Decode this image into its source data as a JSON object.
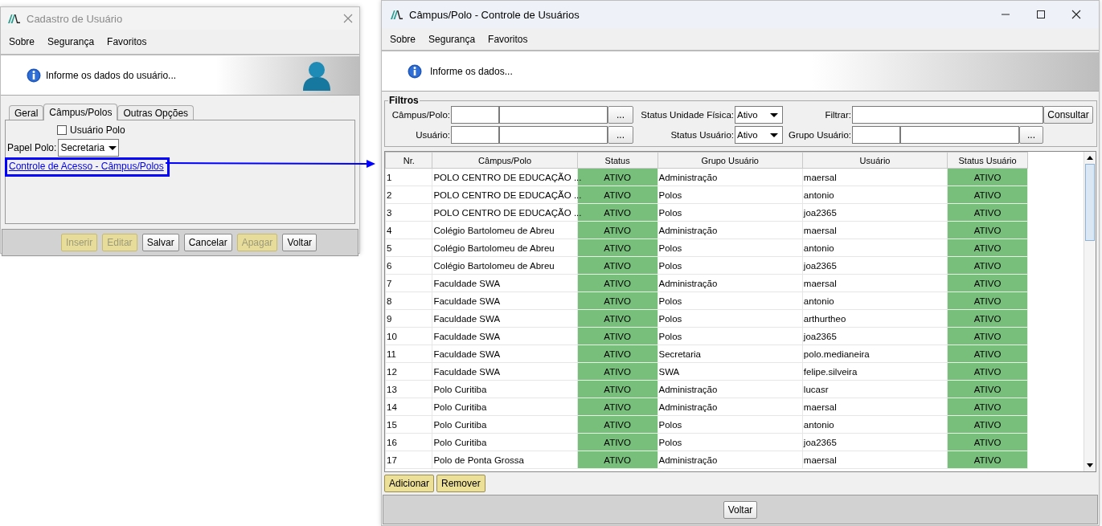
{
  "user_window": {
    "title": "Cadastro de Usuário",
    "menu": [
      "Sobre",
      "Segurança",
      "Favoritos"
    ],
    "banner_text": "Informe os dados do usuário...",
    "tabs": [
      {
        "label": "Geral",
        "selected": false
      },
      {
        "label": "Câmpus/Polos",
        "selected": true
      },
      {
        "label": "Outras Opções",
        "selected": false
      }
    ],
    "polo_user": {
      "label": "Usuário Polo",
      "checked": false
    },
    "role": {
      "label": "Papel Polo:",
      "value": "Secretaria"
    },
    "link": "Controle de Acesso - Câmpus/Polos",
    "buttons": [
      {
        "label": "Inserir",
        "disabled": true
      },
      {
        "label": "Editar",
        "disabled": true
      },
      {
        "label": "Salvar",
        "disabled": false
      },
      {
        "label": "Cancelar",
        "disabled": false
      },
      {
        "label": "Apagar",
        "disabled": true
      },
      {
        "label": "Voltar",
        "disabled": false
      }
    ]
  },
  "control_window": {
    "title": "Câmpus/Polo - Controle de Usuários",
    "menu": [
      "Sobre",
      "Segurança",
      "Favoritos"
    ],
    "banner_text": "Informe os dados...",
    "filters": {
      "title": "Filtros",
      "campus_label": "Câmpus/Polo:",
      "campus_browse": "...",
      "unit_status_label": "Status Unidade Física:",
      "unit_status_value": "Ativo",
      "filter_label": "Filtrar:",
      "search_button": "Consultar",
      "user_label": "Usuário:",
      "user_browse": "...",
      "user_status_label": "Status Usuário:",
      "user_status_value": "Ativo",
      "group_label": "Grupo Usuário:",
      "group_browse": "..."
    },
    "table": {
      "columns": [
        "Nr.",
        "Câmpus/Polo",
        "Status",
        "Grupo Usuário",
        "Usuário",
        "Status Usuário"
      ],
      "rows": [
        [
          "1",
          "POLO CENTRO DE EDUCAÇÃO ...",
          "ATIVO",
          "Administração",
          "maersal",
          "ATIVO"
        ],
        [
          "2",
          "POLO CENTRO DE EDUCAÇÃO ...",
          "ATIVO",
          "Polos",
          "antonio",
          "ATIVO"
        ],
        [
          "3",
          "POLO CENTRO DE EDUCAÇÃO ...",
          "ATIVO",
          "Polos",
          "joa2365",
          "ATIVO"
        ],
        [
          "4",
          "Colégio Bartolomeu de Abreu",
          "ATIVO",
          "Administração",
          "maersal",
          "ATIVO"
        ],
        [
          "5",
          "Colégio Bartolomeu de Abreu",
          "ATIVO",
          "Polos",
          "antonio",
          "ATIVO"
        ],
        [
          "6",
          "Colégio Bartolomeu de Abreu",
          "ATIVO",
          "Polos",
          "joa2365",
          "ATIVO"
        ],
        [
          "7",
          "Faculdade SWA",
          "ATIVO",
          "Administração",
          "maersal",
          "ATIVO"
        ],
        [
          "8",
          "Faculdade SWA",
          "ATIVO",
          "Polos",
          "antonio",
          "ATIVO"
        ],
        [
          "9",
          "Faculdade SWA",
          "ATIVO",
          "Polos",
          "arthurtheo",
          "ATIVO"
        ],
        [
          "10",
          "Faculdade SWA",
          "ATIVO",
          "Polos",
          "joa2365",
          "ATIVO"
        ],
        [
          "11",
          "Faculdade SWA",
          "ATIVO",
          "Secretaria",
          "polo.medianeira",
          "ATIVO"
        ],
        [
          "12",
          "Faculdade SWA",
          "ATIVO",
          "SWA",
          "felipe.silveira",
          "ATIVO"
        ],
        [
          "13",
          "Polo Curitiba",
          "ATIVO",
          "Administração",
          "lucasr",
          "ATIVO"
        ],
        [
          "14",
          "Polo Curitiba",
          "ATIVO",
          "Administração",
          "maersal",
          "ATIVO"
        ],
        [
          "15",
          "Polo Curitiba",
          "ATIVO",
          "Polos",
          "antonio",
          "ATIVO"
        ],
        [
          "16",
          "Polo Curitiba",
          "ATIVO",
          "Polos",
          "joa2365",
          "ATIVO"
        ],
        [
          "17",
          "Polo de Ponta Grossa",
          "ATIVO",
          "Administração",
          "maersal",
          "ATIVO"
        ]
      ]
    },
    "list_buttons": [
      "Adicionar",
      "Remover"
    ],
    "back_button": "Voltar"
  }
}
